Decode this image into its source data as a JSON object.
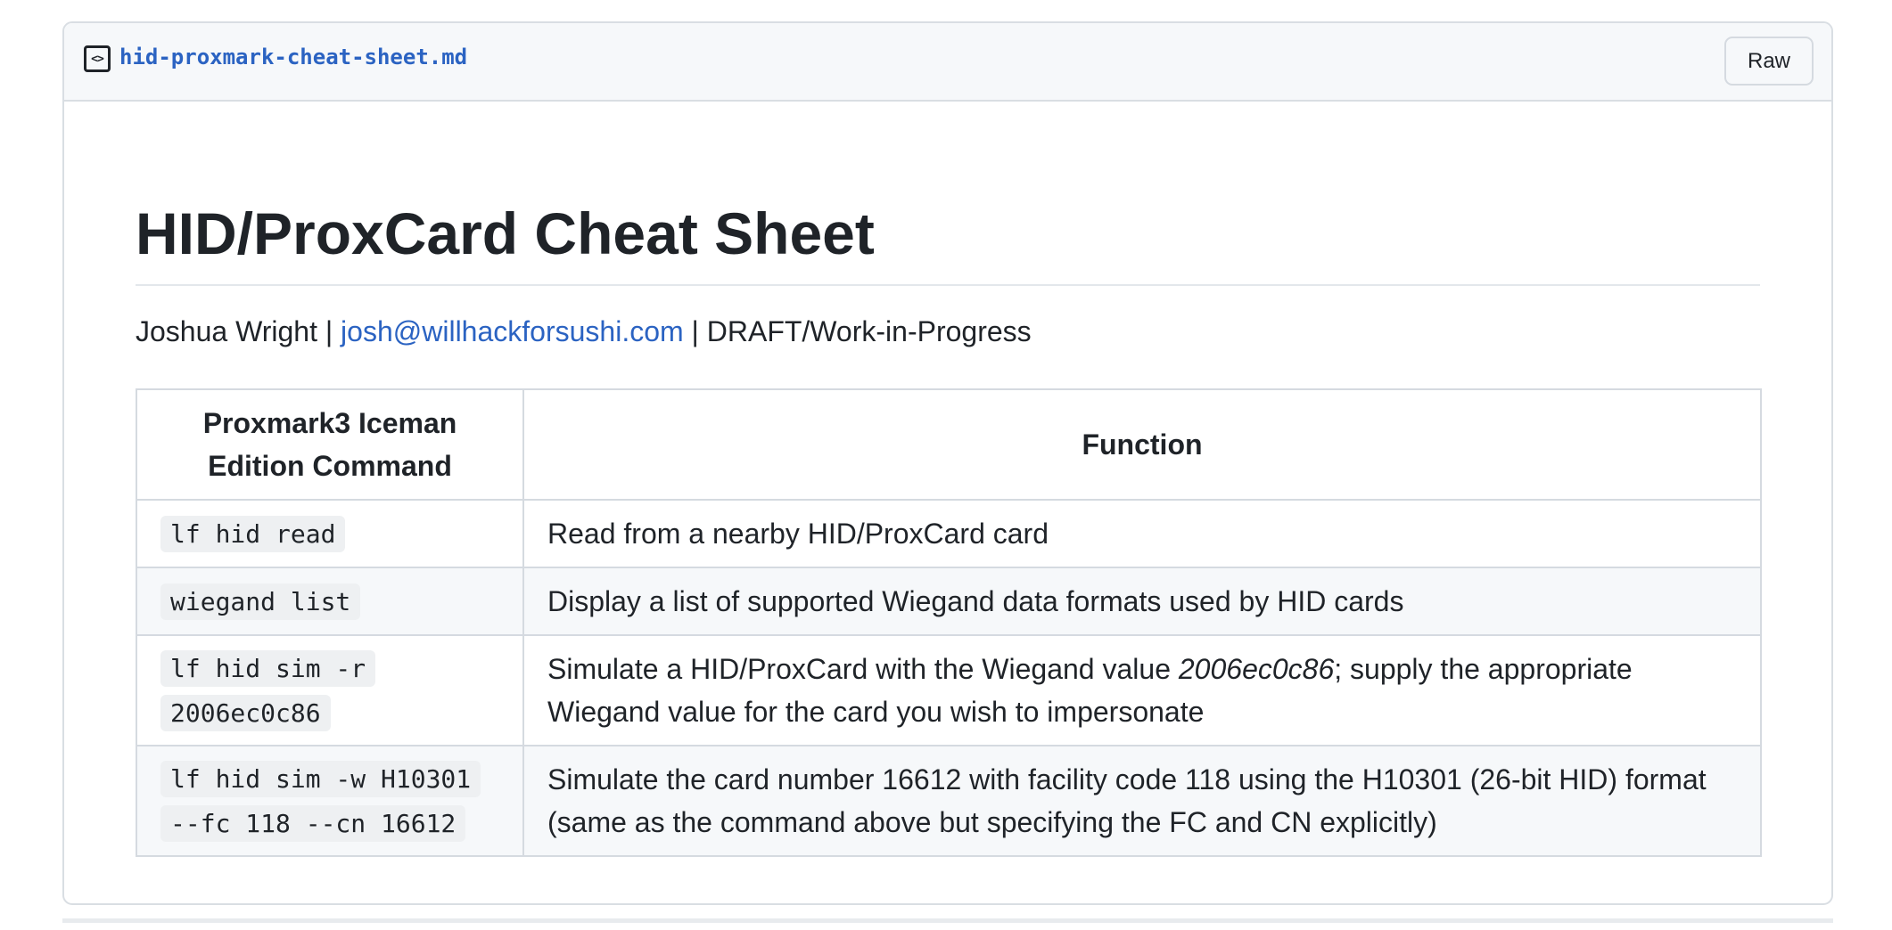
{
  "file": {
    "icon": "code-file-icon",
    "name": "hid-proxmark-cheat-sheet.md",
    "raw_label": "Raw"
  },
  "doc": {
    "title": "HID/ProxCard Cheat Sheet",
    "byline": {
      "author": "Joshua Wright",
      "sep1": " | ",
      "email": "josh@willhackforsushi.com",
      "sep2": " | ",
      "status": "DRAFT/Work-in-Progress"
    }
  },
  "table": {
    "headers": [
      "Proxmark3 Iceman Edition Command",
      "Function"
    ],
    "rows": [
      {
        "command": "lf hid read",
        "function": "Read from a nearby HID/ProxCard card"
      },
      {
        "command": "wiegand list",
        "function": "Display a list of supported Wiegand data formats used by HID cards"
      },
      {
        "command": "lf hid sim -r 2006ec0c86",
        "function_before": "Simulate a HID/ProxCard with the Wiegand value ",
        "function_em": "2006ec0c86",
        "function_after": "; supply the appropriate Wiegand value for the card you wish to impersonate"
      },
      {
        "command": "lf hid sim -w H10301 --fc 118 --cn 16612",
        "function": "Simulate the card number 16612 with facility code 118 using the H10301 (26-bit HID) format (same as the command above but specifying the FC and CN explicitly)"
      }
    ]
  },
  "colors": {
    "link": "#2b63c2",
    "text": "#1f2328",
    "header_bg": "#f6f8fa",
    "border": "#d5dae0"
  }
}
